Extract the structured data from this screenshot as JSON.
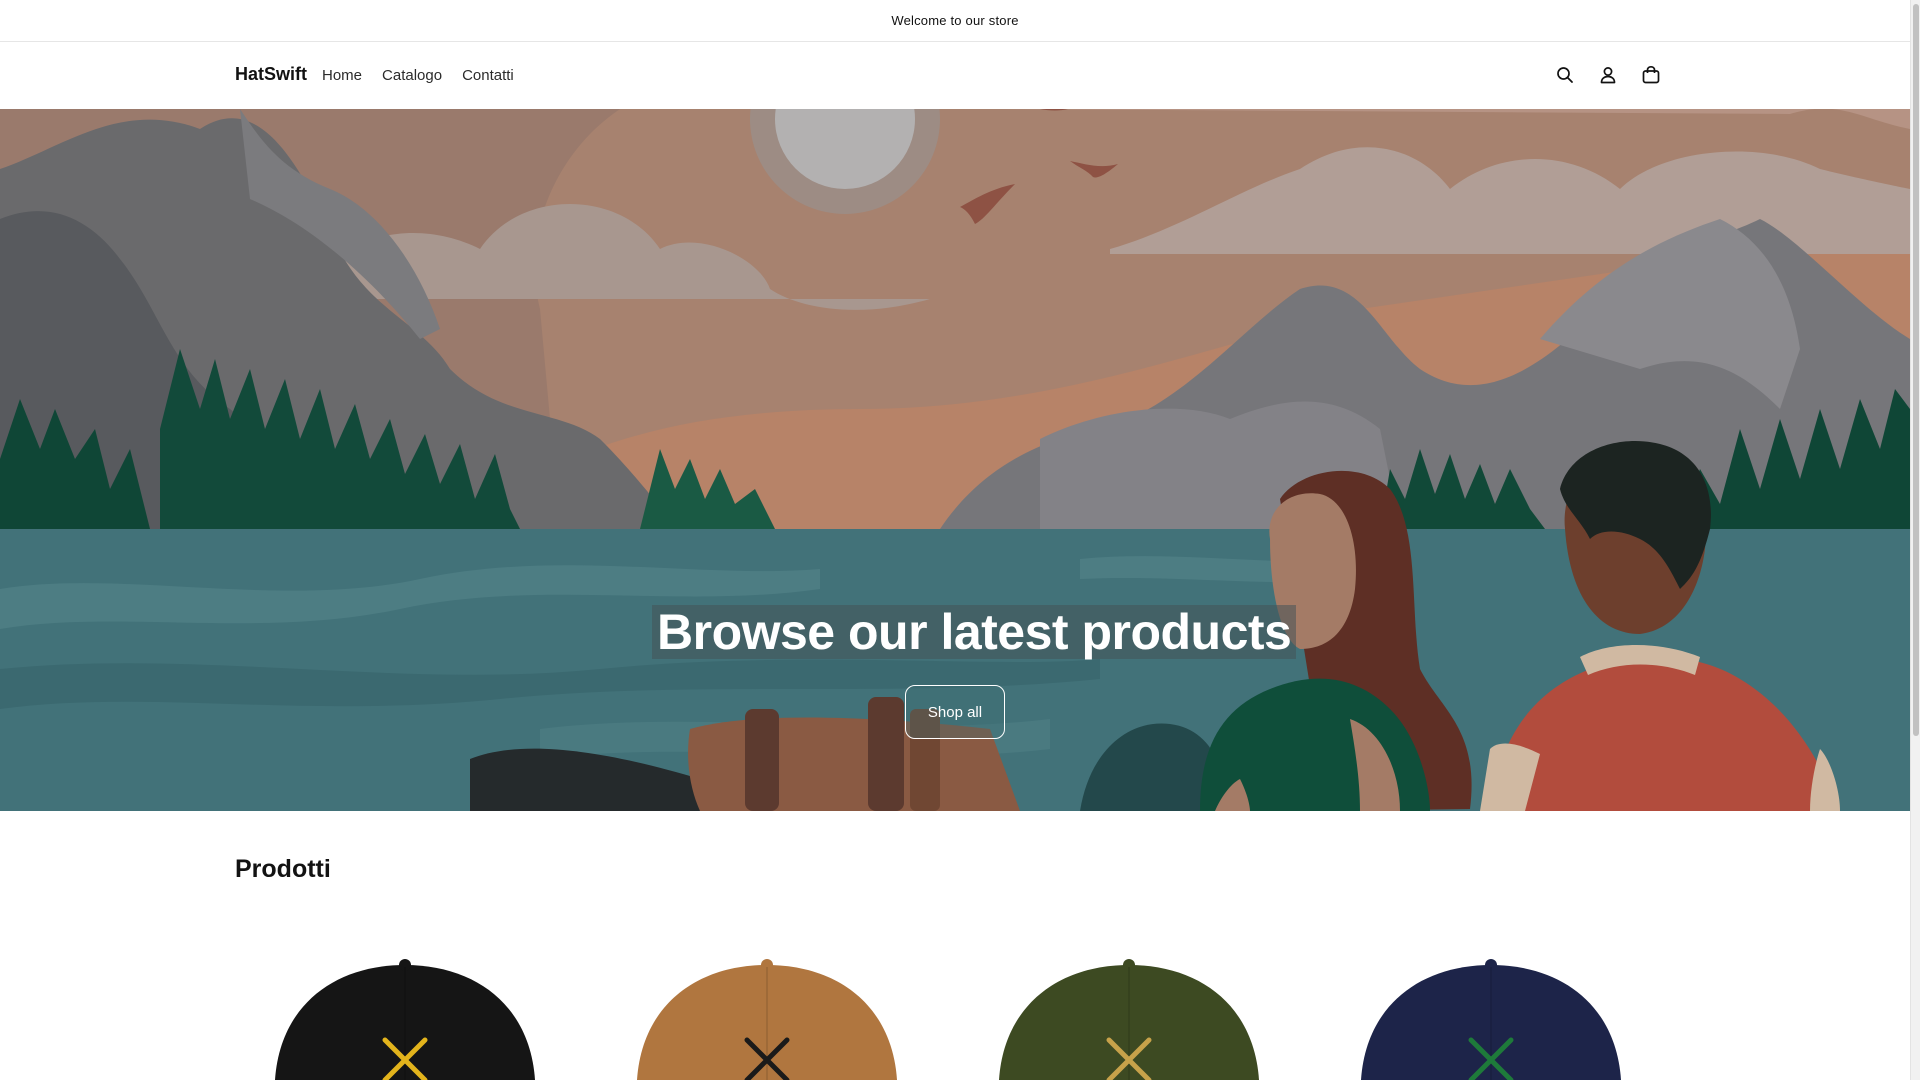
{
  "announcement": {
    "text": "Welcome to our store"
  },
  "header": {
    "logo": "HatSwift",
    "nav": [
      "Home",
      "Catalogo",
      "Contatti"
    ],
    "icons": [
      "search-icon",
      "account-icon",
      "cart-icon"
    ]
  },
  "hero": {
    "heading": "Browse our latest products",
    "button_label": "Shop all"
  },
  "products": {
    "title": "Prodotti",
    "items": [
      {
        "color": "#151515",
        "logo_color": "#e3b41c"
      },
      {
        "color": "#b0763f",
        "logo_color": "#1a1a1a"
      },
      {
        "color": "#3d4a22",
        "logo_color": "#c7a24a"
      },
      {
        "color": "#1d2449",
        "logo_color": "#1e7a3a"
      }
    ]
  },
  "colors": {
    "accent": "#121212",
    "hero_sky": "#a7826f",
    "hero_lake": "#427279"
  }
}
